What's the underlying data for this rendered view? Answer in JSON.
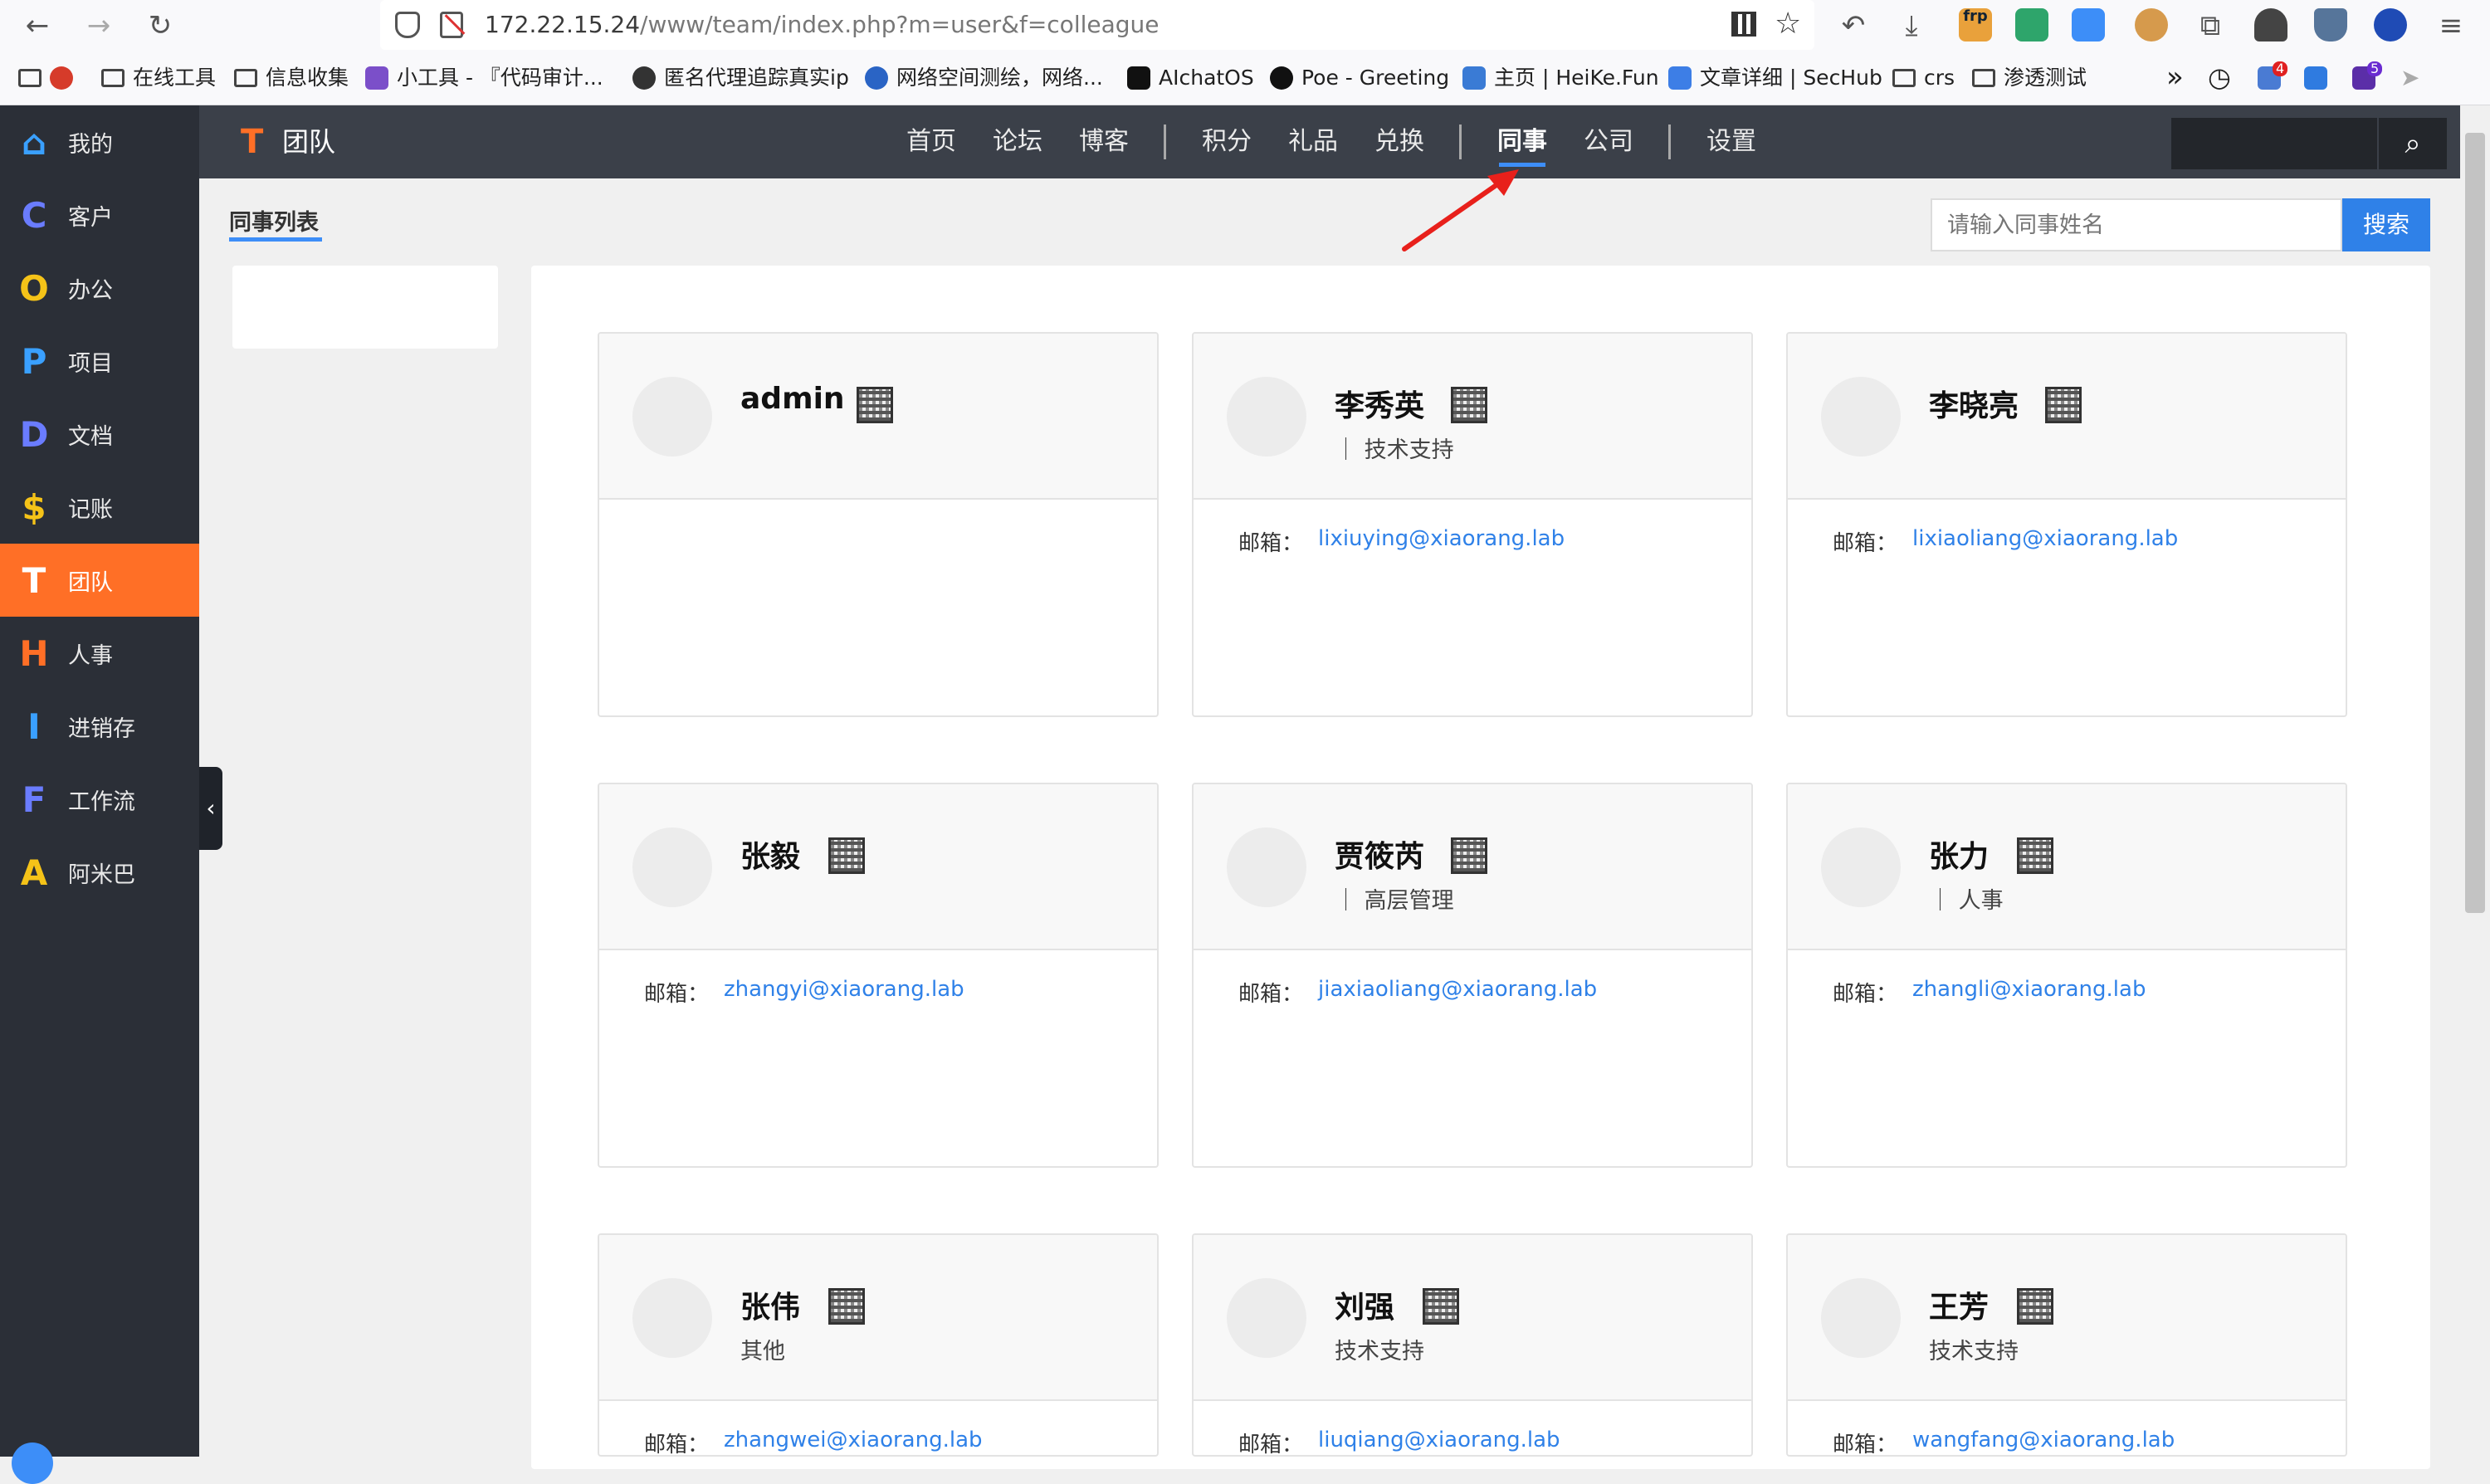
{
  "browser": {
    "url_host": "172.22.15.24",
    "url_path": "/www/team/index.php?m=user&f=colleague",
    "bookmarks": [
      {
        "label": "",
        "type": "folder"
      },
      {
        "label": "在线工具",
        "type": "folder"
      },
      {
        "label": "信息收集",
        "type": "folder"
      },
      {
        "label": "小工具 - 『代码审计...",
        "type": "site"
      },
      {
        "label": "匿名代理追踪真实ip",
        "type": "site"
      },
      {
        "label": "网络空间测绘，网络...",
        "type": "site"
      },
      {
        "label": "AIchatOS",
        "type": "site"
      },
      {
        "label": "Poe - Greeting",
        "type": "site"
      },
      {
        "label": "主页 | HeiKe.Fun",
        "type": "site"
      },
      {
        "label": "文章详细 | SecHub",
        "type": "site"
      },
      {
        "label": "crs",
        "type": "folder"
      },
      {
        "label": "渗透测试",
        "type": "folder"
      }
    ],
    "ext_badge_1": "frp",
    "ext_badge_2": "4",
    "ext_badge_3": "5"
  },
  "sidebar": {
    "items": [
      {
        "letter": "⌂",
        "label": "我的",
        "color": "#3aa0ff"
      },
      {
        "letter": "C",
        "label": "客户",
        "color": "#6a7cff"
      },
      {
        "letter": "O",
        "label": "办公",
        "color": "#f5c318"
      },
      {
        "letter": "P",
        "label": "项目",
        "color": "#3aa0ff"
      },
      {
        "letter": "D",
        "label": "文档",
        "color": "#6a7cff"
      },
      {
        "letter": "$",
        "label": "记账",
        "color": "#f5c318"
      },
      {
        "letter": "T",
        "label": "团队",
        "color": "#ffffff"
      },
      {
        "letter": "H",
        "label": "人事",
        "color": "#ff6f26"
      },
      {
        "letter": "I",
        "label": "进销存",
        "color": "#3aa0ff"
      },
      {
        "letter": "F",
        "label": "工作流",
        "color": "#6a7cff"
      },
      {
        "letter": "A",
        "label": "阿米巴",
        "color": "#f5c318"
      }
    ]
  },
  "header": {
    "app_letter": "T",
    "app_name": "团队",
    "menu": [
      "首页",
      "论坛",
      "博客",
      "积分",
      "礼品",
      "兑换",
      "同事",
      "公司",
      "设置"
    ],
    "active_menu": "同事"
  },
  "content": {
    "section_title": "同事列表",
    "search_placeholder": "请输入同事姓名",
    "search_button": "搜索",
    "email_label": "邮箱：",
    "colleagues": [
      {
        "name": "admin",
        "dept": "",
        "email": ""
      },
      {
        "name": "李秀英",
        "dept": "｜ 技术支持",
        "email": "lixiuying@xiaorang.lab"
      },
      {
        "name": "李晓亮",
        "dept": "",
        "email": "lixiaoliang@xiaorang.lab"
      },
      {
        "name": "张毅",
        "dept": "",
        "email": "zhangyi@xiaorang.lab"
      },
      {
        "name": "贾筱芮",
        "dept": "｜ 高层管理",
        "email": "jiaxiaoliang@xiaorang.lab"
      },
      {
        "name": "张力",
        "dept": "｜ 人事",
        "email": "zhangli@xiaorang.lab"
      },
      {
        "name": "张伟",
        "dept": "其他",
        "email": "zhangwei@xiaorang.lab"
      },
      {
        "name": "刘强",
        "dept": "技术支持",
        "email": "liuqiang@xiaorang.lab"
      },
      {
        "name": "王芳",
        "dept": "技术支持",
        "email": "wangfang@xiaorang.lab"
      }
    ]
  },
  "colors": {
    "accent": "#ff6f26",
    "link": "#2f81e8",
    "annotation_arrow": "#e8201b"
  }
}
